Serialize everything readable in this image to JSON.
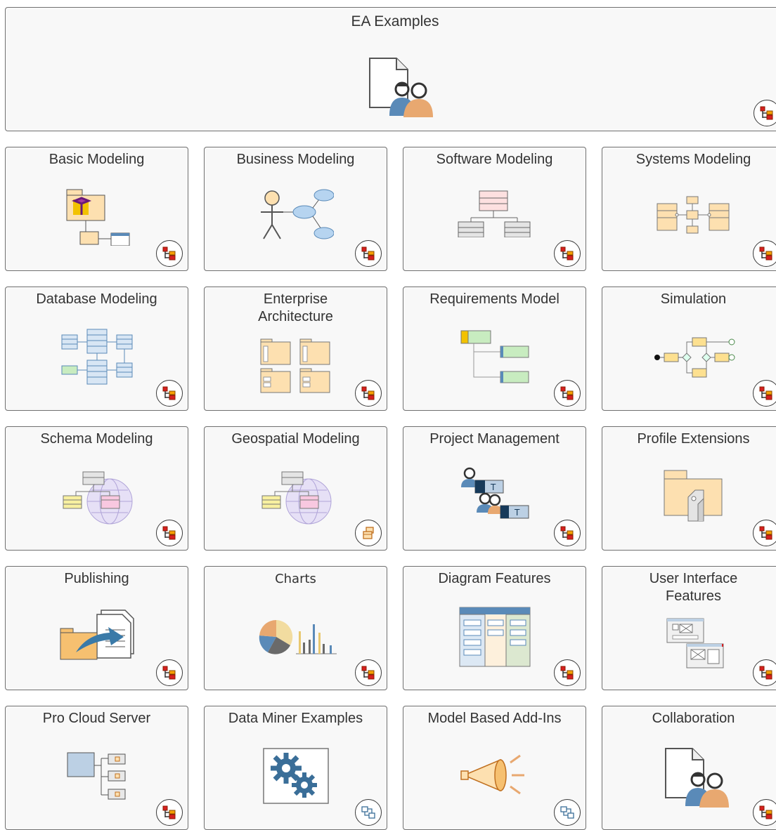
{
  "header": {
    "title": "EA Examples",
    "icon": "user-document-icon",
    "nav_icon": "model-tree-icon"
  },
  "cards": [
    {
      "title": "Basic Modeling",
      "icon": "package-component-icon",
      "nav_icon": "model-tree-icon"
    },
    {
      "title": "Business Modeling",
      "icon": "actor-usecase-icon",
      "nav_icon": "model-tree-icon"
    },
    {
      "title": "Software Modeling",
      "icon": "class-hierarchy-icon",
      "nav_icon": "model-tree-icon"
    },
    {
      "title": "Systems Modeling",
      "icon": "block-diagram-icon",
      "nav_icon": "model-tree-icon"
    },
    {
      "title": "Database Modeling",
      "icon": "database-tables-icon",
      "nav_icon": "model-tree-icon"
    },
    {
      "title": "Enterprise\nArchitecture",
      "icon": "architecture-packages-icon",
      "nav_icon": "model-tree-icon"
    },
    {
      "title": "Requirements Model",
      "icon": "requirements-tree-icon",
      "nav_icon": "model-tree-icon"
    },
    {
      "title": "Simulation",
      "icon": "simulation-flow-icon",
      "nav_icon": "model-tree-icon"
    },
    {
      "title": "Schema Modeling",
      "icon": "schema-globe-icon",
      "nav_icon": "model-tree-icon"
    },
    {
      "title": "Geospatial Modeling",
      "icon": "geospatial-globe-icon",
      "nav_icon": "package-stack-icon"
    },
    {
      "title": "Project Management",
      "icon": "project-team-icon",
      "nav_icon": "model-tree-icon"
    },
    {
      "title": "Profile Extensions",
      "icon": "profile-package-icon",
      "nav_icon": "model-tree-icon"
    },
    {
      "title": "Publishing",
      "icon": "publish-document-icon",
      "nav_icon": "model-tree-icon"
    },
    {
      "title": "Charts",
      "icon": "pie-bar-chart-icon",
      "nav_icon": "model-tree-icon"
    },
    {
      "title": "Diagram Features",
      "icon": "diagram-layout-icon",
      "nav_icon": "model-tree-icon"
    },
    {
      "title": "User Interface\nFeatures",
      "icon": "ui-screens-icon",
      "nav_icon": "model-tree-icon"
    },
    {
      "title": "Pro Cloud Server",
      "icon": "cloud-server-icon",
      "nav_icon": "model-tree-icon"
    },
    {
      "title": "Data Miner Examples",
      "icon": "gears-icon",
      "nav_icon": "diagram-link-icon"
    },
    {
      "title": "Model Based Add-Ins",
      "icon": "megaphone-icon",
      "nav_icon": "diagram-link-icon"
    },
    {
      "title": "Collaboration",
      "icon": "user-document-icon",
      "nav_icon": "model-tree-icon"
    }
  ],
  "colors": {
    "border": "#707070",
    "card_bg": "#f8f8f8",
    "package": "#fde0b0",
    "accent_red": "#d62020",
    "accent_blue": "#5a8ab8"
  }
}
